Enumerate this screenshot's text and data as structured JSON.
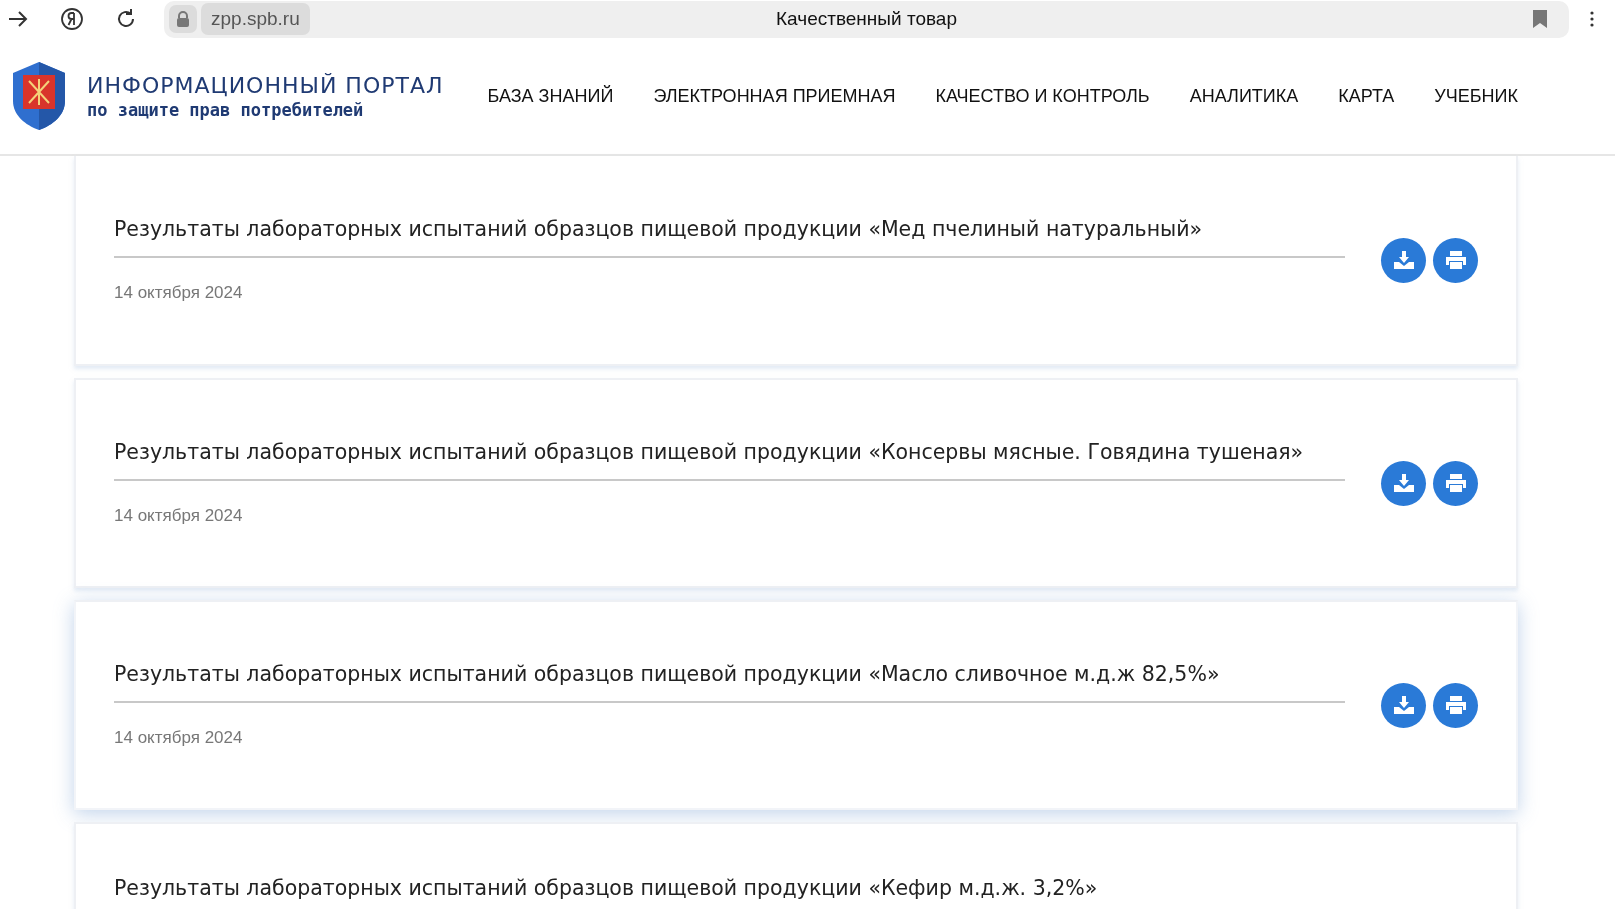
{
  "browser": {
    "url": "zpp.spb.ru",
    "page_title": "Качественный товар"
  },
  "site": {
    "title": "ИНФОРМАЦИОННЫЙ ПОРТАЛ",
    "subtitle": "по защите прав потребителей"
  },
  "nav": [
    {
      "label": "БАЗА ЗНАНИЙ"
    },
    {
      "label": "ЭЛЕКТРОННАЯ ПРИЕМНАЯ"
    },
    {
      "label": "КАЧЕСТВО И КОНТРОЛЬ"
    },
    {
      "label": "АНАЛИТИКА"
    },
    {
      "label": "КАРТА"
    },
    {
      "label": "УЧЕБНИК"
    }
  ],
  "cards": [
    {
      "title": "Результаты лабораторных испытаний образцов пищевой продукции «Мед пчелиный натуральный»",
      "date": "14 октября 2024",
      "highlighted": false
    },
    {
      "title": "Результаты лабораторных испытаний образцов пищевой продукции «Консервы мясные. Говядина тушеная»",
      "date": "14 октября 2024",
      "highlighted": false
    },
    {
      "title": "Результаты лабораторных испытаний образцов пищевой продукции «Масло сливочное м.д.ж 82,5%»",
      "date": "14 октября 2024",
      "highlighted": true
    },
    {
      "title": "Результаты лабораторных испытаний образцов пищевой продукции «Кефир м.д.ж. 3,2%»",
      "highlighted": false
    }
  ]
}
